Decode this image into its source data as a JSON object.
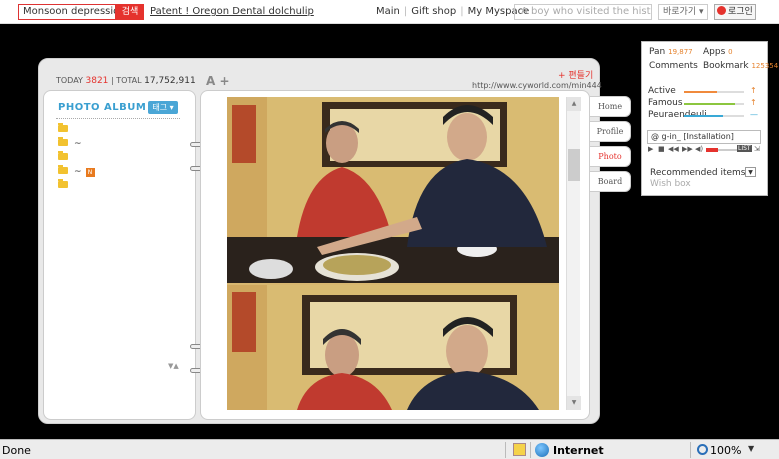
{
  "topbar": {
    "search_value": "Monsoon depression",
    "search_button": "검색",
    "patent_link": "Patent ! Oregon Dental dolchulip",
    "nav": [
      "Main",
      "Gift shop",
      "My Myspace"
    ],
    "search2_placeholder": "A boy who visited the historical",
    "goto_label": "바로가기",
    "login_label": "로그인"
  },
  "counter": {
    "today_label": "TODAY",
    "today": "3821",
    "total_label": "TOTAL",
    "total": "17,752,911"
  },
  "font_size_btn": "A +",
  "edit_label": "+ 편들기",
  "url": "http://www.cyworld.com/min444",
  "album": {
    "title": "PHOTO ALBUM",
    "tag_label": "태그 ▾",
    "folders": [
      {
        "label": "",
        "new": false
      },
      {
        "label": "~",
        "new": false
      },
      {
        "label": "",
        "new": false
      },
      {
        "label": "~",
        "new": true
      },
      {
        "label": "",
        "new": false
      }
    ],
    "nav_arrows": "▼▲"
  },
  "tabs": [
    "Home",
    "Profile",
    "Photo",
    "Board"
  ],
  "active_tab": "Photo",
  "profile": {
    "pan_label": "Pan",
    "pan_value": "19,877",
    "apps_label": "Apps",
    "apps_value": "0",
    "comments_label": "Comments",
    "bookmark_label": "Bookmark",
    "bookmark_value": "125354",
    "stats": [
      {
        "label": "Active",
        "color": "#f08a3c",
        "level": 0.55
      },
      {
        "label": "Famous",
        "color": "#8cc63f",
        "level": 0.85
      },
      {
        "label": "Peuraendeuli",
        "color": "#39a9d6",
        "level": 0.65
      }
    ],
    "music_text": "@ g-in_ [Installation]",
    "music_list": "LIST",
    "recommended_label": "Recommended items",
    "wishbox_label": "Wish box"
  },
  "status": {
    "done": "Done",
    "zone": "Internet",
    "zoom": "100%"
  },
  "colors": {
    "accent": "#e5322d",
    "album_blue": "#3a9fd0"
  }
}
